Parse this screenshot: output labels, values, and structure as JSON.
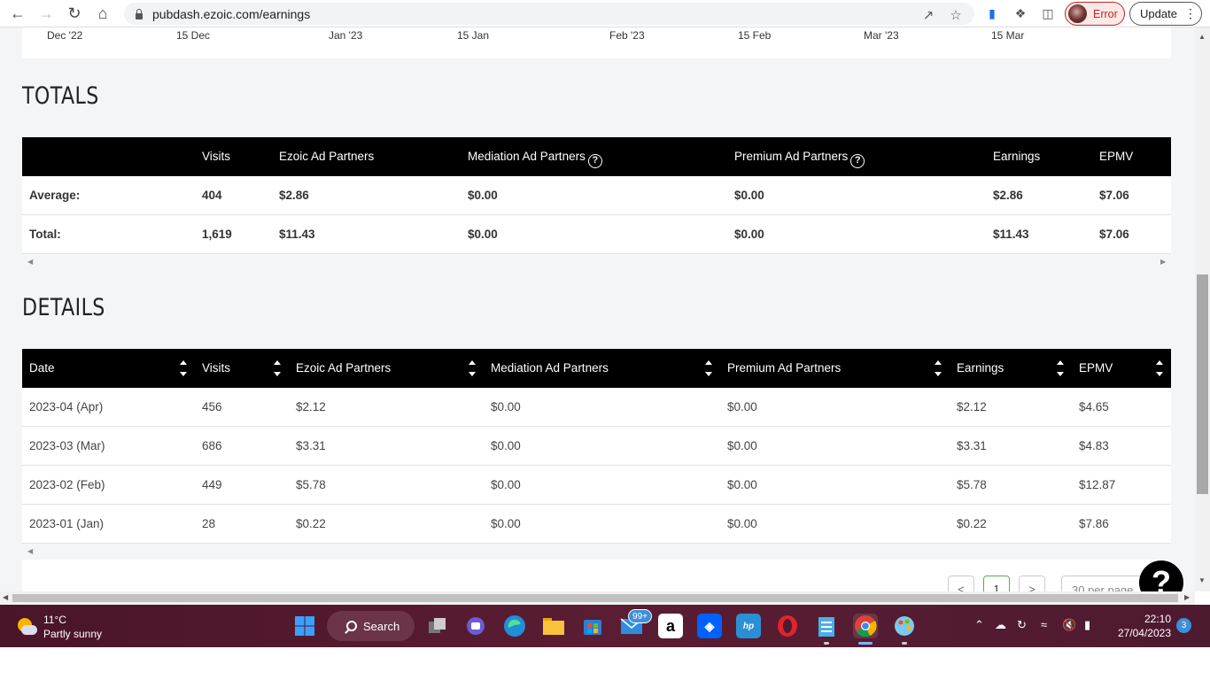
{
  "browser": {
    "url": "pubdash.ezoic.com/earnings",
    "profile_status": "Error",
    "update_label": "Update"
  },
  "chart_axis": {
    "ticks": [
      "Dec '22",
      "15 Dec",
      "Jan '23",
      "15 Jan",
      "Feb '23",
      "15 Feb",
      "Mar '23",
      "15 Mar"
    ]
  },
  "totals": {
    "title": "TOTALS",
    "headers": [
      "",
      "Visits",
      "Ezoic Ad Partners",
      "Mediation Ad Partners",
      "Premium Ad Partners",
      "Earnings",
      "EPMV"
    ],
    "rows": [
      [
        "Average:",
        "404",
        "$2.86",
        "$0.00",
        "$0.00",
        "$2.86",
        "$7.06"
      ],
      [
        "Total:",
        "1,619",
        "$11.43",
        "$0.00",
        "$0.00",
        "$11.43",
        "$7.06"
      ]
    ]
  },
  "details": {
    "title": "DETAILS",
    "headers": [
      "Date",
      "Visits",
      "Ezoic Ad Partners",
      "Mediation Ad Partners",
      "Premium Ad Partners",
      "Earnings",
      "EPMV"
    ],
    "rows": [
      [
        "2023-04 (Apr)",
        "456",
        "$2.12",
        "$0.00",
        "$0.00",
        "$2.12",
        "$4.65"
      ],
      [
        "2023-03 (Mar)",
        "686",
        "$3.31",
        "$0.00",
        "$0.00",
        "$3.31",
        "$4.83"
      ],
      [
        "2023-02 (Feb)",
        "449",
        "$5.78",
        "$0.00",
        "$0.00",
        "$5.78",
        "$12.87"
      ],
      [
        "2023-01 (Jan)",
        "28",
        "$0.22",
        "$0.00",
        "$0.00",
        "$0.22",
        "$7.86"
      ]
    ]
  },
  "pager": {
    "prev": "<",
    "page": "1",
    "next": ">",
    "per_page": "30 per page"
  },
  "help_fab": "?",
  "taskbar": {
    "temp": "11°C",
    "condition": "Partly sunny",
    "search_label": "Search",
    "mail_badge": "99+",
    "time": "22:10",
    "date": "27/04/2023",
    "notifications": "3"
  },
  "colors": {
    "header_bg": "#000000",
    "page_bg": "#f4f5f7",
    "taskbar_bg": "#4e1a30",
    "error_red": "#c5221f"
  }
}
